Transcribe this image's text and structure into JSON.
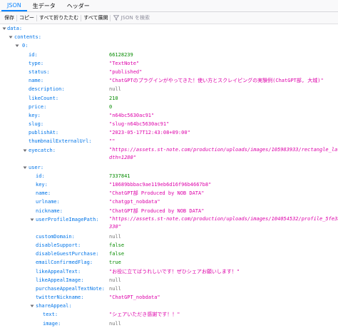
{
  "tabs": [
    {
      "label": "JSON",
      "active": true
    },
    {
      "label": "生データ",
      "active": false
    },
    {
      "label": "ヘッダー",
      "active": false
    }
  ],
  "toolbar": {
    "save": "保存",
    "copy": "コピー",
    "collapse_all": "すべて折りたたむ",
    "expand_all": "すべて展開",
    "filter_placeholder": "JSON を検索"
  },
  "tree": {
    "data": "data:",
    "contents": "contents:",
    "index0": "0:",
    "id": {
      "key": "id:",
      "value": "66128239"
    },
    "type": {
      "key": "type:",
      "value": "\"TextNote\""
    },
    "status": {
      "key": "status:",
      "value": "\"published\""
    },
    "name": {
      "key": "name:",
      "value": "\"ChatGPTのプラグインがやってきた！使い方とスクレイピングの実験例(ChatGPT部, 大城)\""
    },
    "description": {
      "key": "description:",
      "value": "null"
    },
    "likeCount": {
      "key": "likeCount:",
      "value": "210"
    },
    "price": {
      "key": "price:",
      "value": "0"
    },
    "key": {
      "key": "key:",
      "value": "\"n64bc5630ac91\""
    },
    "slug": {
      "key": "slug:",
      "value": "\"slug-n64bc5630ac91\""
    },
    "publishAt": {
      "key": "publishAt:",
      "value": "\"2023-05-17T12:43:08+09:00\""
    },
    "thumbnailExternalUrl": {
      "key": "thumbnailExternalUrl:",
      "value": "\"\""
    },
    "eyecatch": {
      "key": "eyecatch:",
      "value": "\"https://assets.st-note.com/production/uploads/images/105983933/rectangle_large_type_2_...width=1280\"",
      "line1": "\"https://assets.st-note.com/production/uploads/images/105983933/rectangle_large",
      "line2": "dth=1280\""
    },
    "user": {
      "label": "user:",
      "id": {
        "key": "id:",
        "value": "7337841"
      },
      "key": {
        "key": "key:",
        "value": "\"18689bbbac9ae119eb6d16f96b4667b8\""
      },
      "name": {
        "key": "name:",
        "value": "\"ChatGPT部 Produced by NOB DATA\""
      },
      "urlname": {
        "key": "urlname:",
        "value": "\"chatgpt_nobdata\""
      },
      "nickname": {
        "key": "nickname:",
        "value": "\"ChatGPT部 Produced by NOB DATA\""
      },
      "userProfileImagePath": {
        "key": "userProfileImagePath:",
        "line1": "\"https://assets.st-note.com/production/uploads/images/104054532/profile_5fe3a23",
        "line2": "330\""
      },
      "customDomain": {
        "key": "customDomain:",
        "value": "null"
      },
      "disableSupport": {
        "key": "disableSupport:",
        "value": "false"
      },
      "disableGuestPurchase": {
        "key": "disableGuestPurchase:",
        "value": "false"
      },
      "emailConfirmedFlag": {
        "key": "emailConfirmedFlag:",
        "value": "true"
      },
      "likeAppealText": {
        "key": "likeAppealText:",
        "value": "\"お役に立てばうれしいです！ぜひシェアお願いします！\""
      },
      "likeAppealImage": {
        "key": "likeAppealImage:",
        "value": "null"
      },
      "purchaseAppealTextNote": {
        "key": "purchaseAppealTextNote:",
        "value": "null"
      },
      "twitterNickname": {
        "key": "twitterNickname:",
        "value": "\"ChatGPT_nobdata\""
      },
      "shareAppeal": {
        "label": "shareAppeal:",
        "text": {
          "key": "text:",
          "value": "\"シェアいただき感謝です！！\""
        },
        "image": {
          "key": "image:",
          "value": "null"
        }
      }
    }
  },
  "colors": {
    "key": "#0074e8",
    "string": "#dd00a9",
    "number": "#058b00",
    "null": "#737373",
    "accent": "#0a84ff"
  }
}
